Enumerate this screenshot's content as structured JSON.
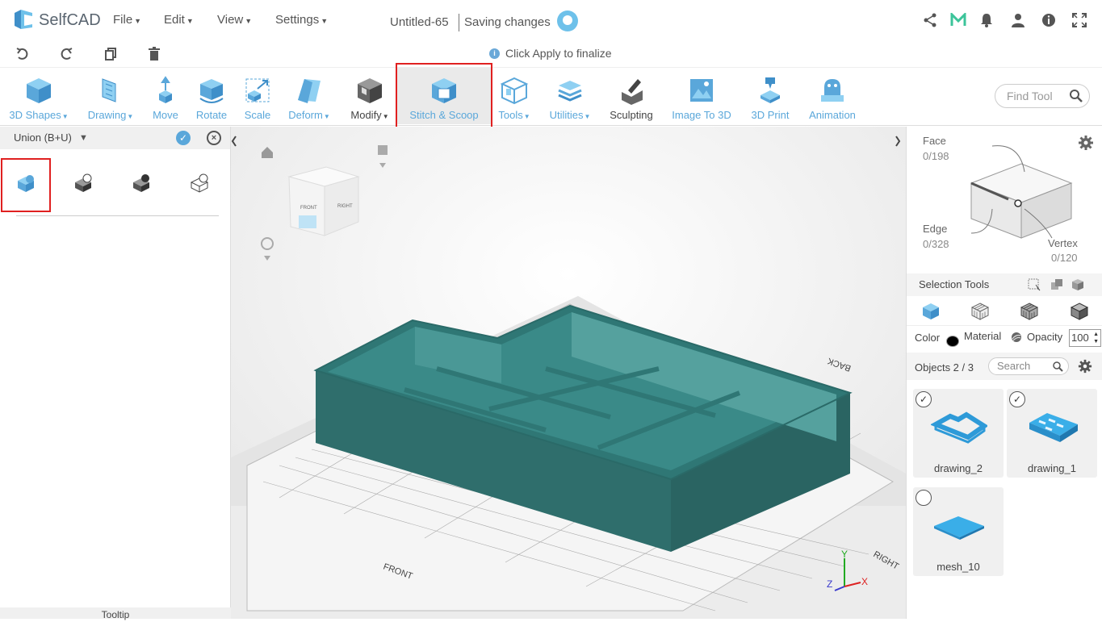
{
  "app": {
    "name": "SelfCAD"
  },
  "menu": [
    {
      "label": "File"
    },
    {
      "label": "Edit"
    },
    {
      "label": "View"
    },
    {
      "label": "Settings"
    }
  ],
  "document": {
    "title": "Untitled-65",
    "status": "Saving changes"
  },
  "hint": {
    "text": "Click Apply to finalize"
  },
  "ribbon": {
    "tools": [
      {
        "label": "3D Shapes",
        "dropdown": true
      },
      {
        "label": "Drawing",
        "dropdown": true
      },
      {
        "label": "Move",
        "dropdown": false
      },
      {
        "label": "Rotate",
        "dropdown": false
      },
      {
        "label": "Scale",
        "dropdown": false
      },
      {
        "label": "Deform",
        "dropdown": true
      },
      {
        "label": "Modify",
        "dropdown": true
      },
      {
        "label": "Stitch & Scoop",
        "dropdown": false,
        "active": true
      },
      {
        "label": "Tools",
        "dropdown": true
      },
      {
        "label": "Utilities",
        "dropdown": true
      },
      {
        "label": "Sculpting",
        "dropdown": false
      },
      {
        "label": "Image To 3D",
        "dropdown": false
      },
      {
        "label": "3D Print",
        "dropdown": false
      },
      {
        "label": "Animation",
        "dropdown": false
      }
    ],
    "find_tool_placeholder": "Find Tool"
  },
  "left_panel": {
    "operation": "Union (B+U)",
    "tooltip_label": "Tooltip"
  },
  "viewport": {
    "view_cube": {
      "front": "FRONT",
      "right": "RIGHT"
    },
    "floor_labels": {
      "front": "FRONT",
      "back": "BACK",
      "right": "RIGHT"
    },
    "axes": {
      "x": "X",
      "y": "Y",
      "z": "Z"
    }
  },
  "right_panel": {
    "face": {
      "label": "Face",
      "count": "0/198"
    },
    "edge": {
      "label": "Edge",
      "count": "0/328"
    },
    "vertex": {
      "label": "Vertex",
      "count": "0/120"
    },
    "selection_tools_label": "Selection Tools",
    "color_label": "Color",
    "material_label": "Material",
    "opacity_label": "Opacity",
    "opacity_value": "100",
    "objects_label": "Objects 2 / 3",
    "search_placeholder": "Search",
    "objects": [
      {
        "name": "drawing_2",
        "checked": true
      },
      {
        "name": "drawing_1",
        "checked": true
      },
      {
        "name": "mesh_10",
        "checked": false
      }
    ]
  },
  "colors": {
    "accent": "#5aa7da",
    "model": "#2f7775",
    "highlight": "#e02020"
  }
}
